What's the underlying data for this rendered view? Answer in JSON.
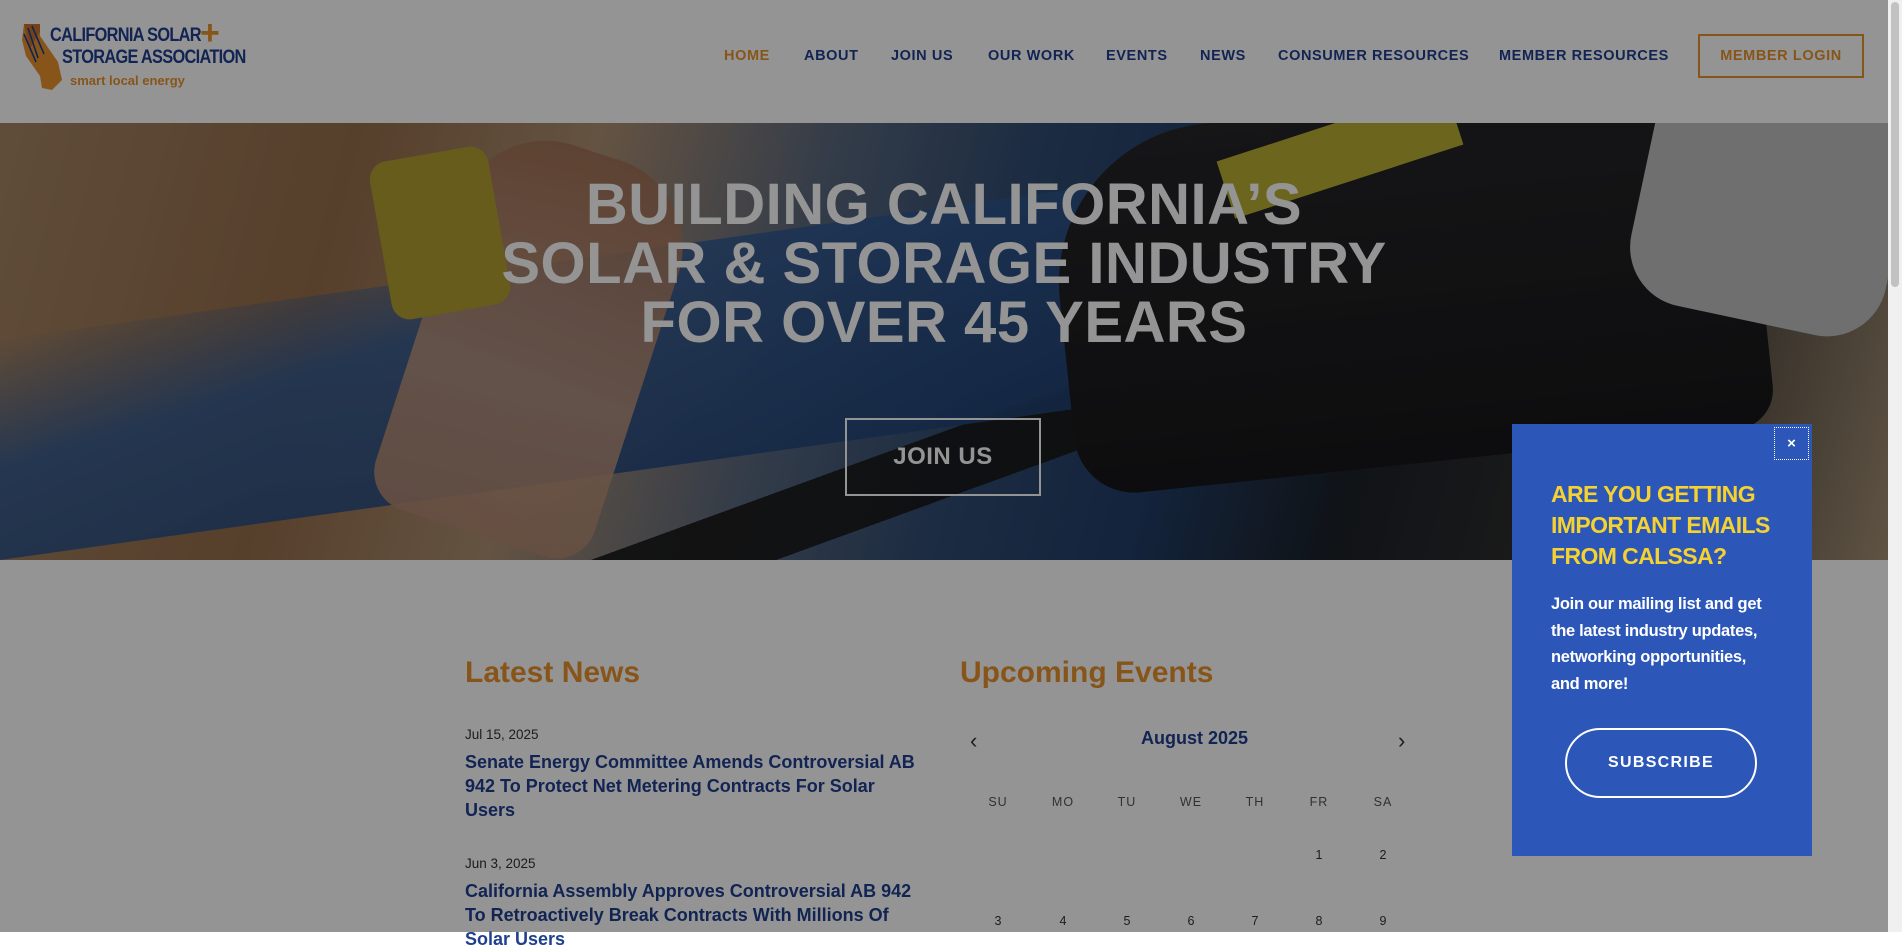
{
  "brand": {
    "line1": "CALIFORNIA SOLAR",
    "line2": "STORAGE ASSOCIATION",
    "plus": "+",
    "tagline": "smart local energy",
    "colors": {
      "navy": "#1f3f8f",
      "orange": "#e8932d",
      "popup_blue": "#2c57b8",
      "popup_yellow": "#f5d230"
    }
  },
  "nav": {
    "items": [
      "HOME",
      "ABOUT",
      "JOIN US",
      "OUR WORK",
      "EVENTS",
      "NEWS",
      "CONSUMER RESOURCES",
      "MEMBER RESOURCES"
    ],
    "active": "HOME",
    "login_label": "MEMBER LOGIN"
  },
  "hero": {
    "title_lines": [
      "BUILDING CALIFORNIA’S",
      "SOLAR & STORAGE INDUSTRY",
      "FOR OVER 45 YEARS"
    ],
    "button_label": "JOIN US"
  },
  "news": {
    "heading": "Latest News",
    "items": [
      {
        "date": "Jul 15, 2025",
        "title": "Senate Energy Committee Amends Controversial AB 942 To Protect Net Metering Contracts For Solar Users"
      },
      {
        "date": "Jun 3, 2025",
        "title": "California Assembly Approves Controversial AB 942 To Retroactively Break Contracts With Millions Of Solar Users"
      }
    ]
  },
  "events": {
    "heading": "Upcoming Events",
    "calendar": {
      "month": "August 2025",
      "prev_icon": "chevron-left-icon",
      "next_icon": "chevron-right-icon",
      "weekdays": [
        "SU",
        "MO",
        "TU",
        "WE",
        "TH",
        "FR",
        "SA"
      ],
      "week1": [
        "",
        "",
        "",
        "",
        "",
        "1",
        "2"
      ],
      "week2": [
        "3",
        "4",
        "5",
        "6",
        "7",
        "8",
        "9"
      ]
    }
  },
  "popup": {
    "close_label": "×",
    "heading": "ARE YOU GETTING IMPORTANT EMAILS FROM CALSSA?",
    "body": "Join our mailing list and get the latest industry updates, networking opportunities, and more!",
    "button_label": "SUBSCRIBE"
  }
}
